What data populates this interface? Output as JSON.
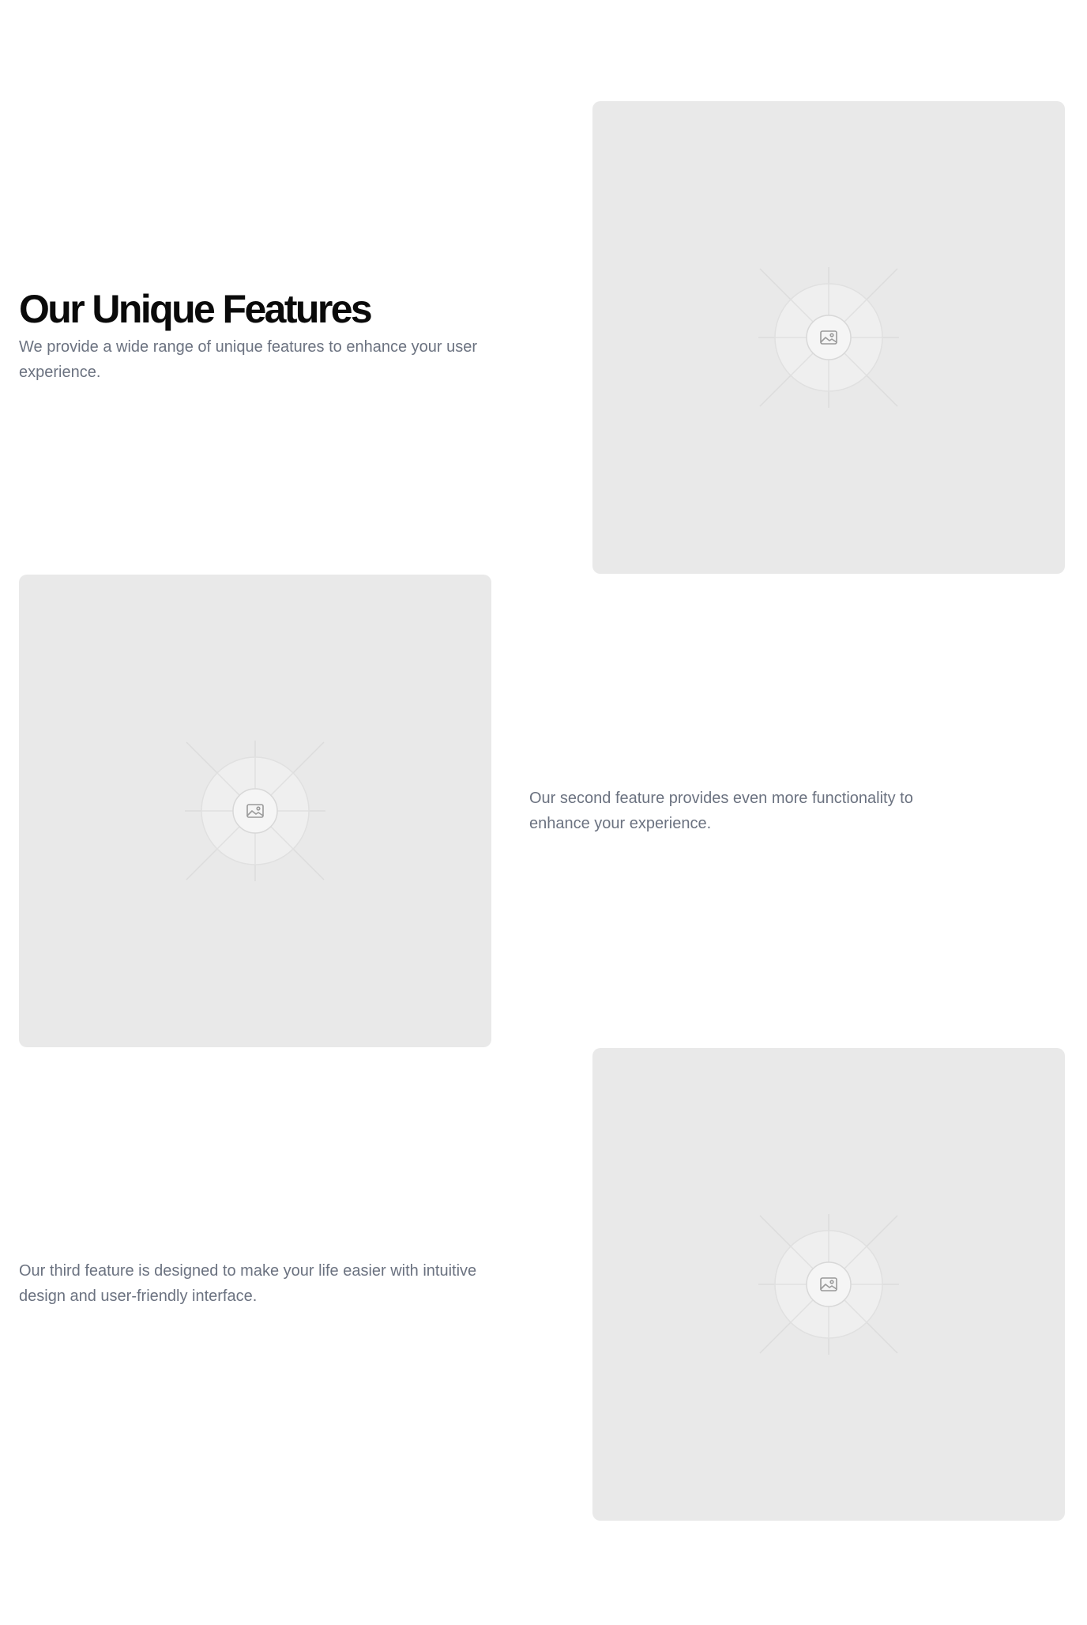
{
  "header": {
    "title": "Our Unique Features",
    "description": "We provide a wide range of unique features to enhance your user experience."
  },
  "features": [
    {
      "image_icon": "image-placeholder-icon"
    },
    {
      "image_icon": "image-placeholder-icon",
      "description": "Our second feature provides even more functionality to enhance your experience."
    },
    {
      "image_icon": "image-placeholder-icon",
      "description": "Our third feature is designed to make your life easier with intuitive design and user-friendly interface."
    }
  ],
  "colors": {
    "heading": "#0a0a0a",
    "body_text": "#6b7280",
    "placeholder_bg": "#e9e9e9",
    "page_bg": "#ffffff"
  }
}
